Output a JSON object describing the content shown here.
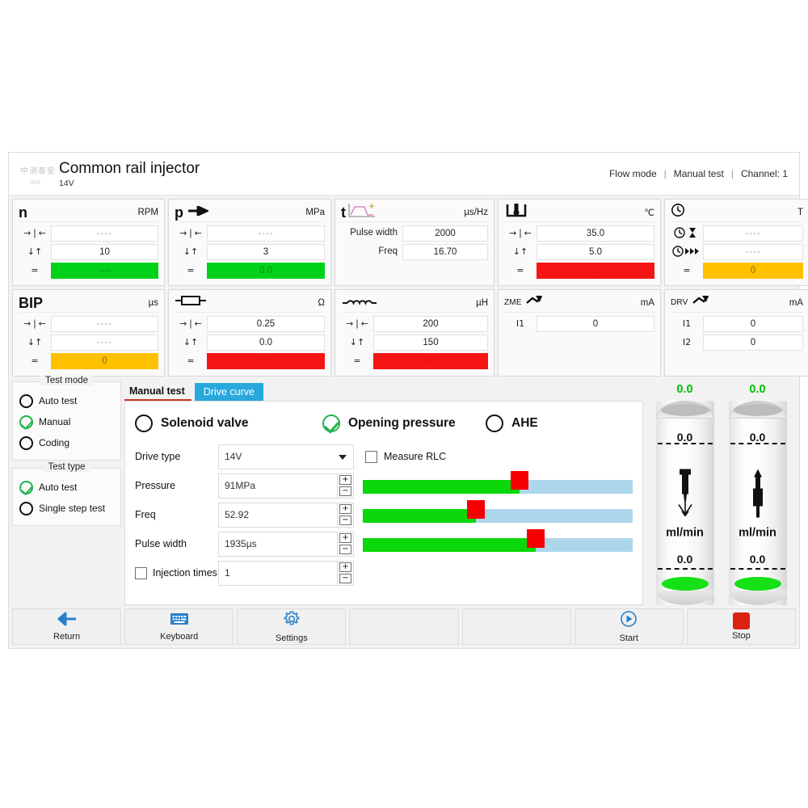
{
  "header": {
    "title": "Common rail injector",
    "subtitle": "14V",
    "logo_text": "中测泰安",
    "logo_sub": "test",
    "status": [
      "Flow mode",
      "Manual test",
      "Channel: 1"
    ],
    "separator": "|"
  },
  "gauges": [
    {
      "name": "speed",
      "symbol": "n",
      "unit": "RPM",
      "icon_head": "",
      "rows": [
        {
          "icon": "→❘←",
          "value": "----",
          "style": "dim"
        },
        {
          "icon": "↓↑",
          "value": "10",
          "style": "plain"
        },
        {
          "icon": "=",
          "value": "----",
          "style": "green"
        }
      ]
    },
    {
      "name": "bip",
      "symbol": "BIP",
      "unit": "µs",
      "rows": [
        {
          "icon": "→❘←",
          "value": "----",
          "style": "dim"
        },
        {
          "icon": "↓↑",
          "value": "----",
          "style": "dim"
        },
        {
          "icon": "=",
          "value": "0",
          "style": "amber"
        }
      ]
    },
    {
      "name": "pressure",
      "symbol": "p",
      "unit": "MPa",
      "icon_head": "arrow-right-icon",
      "rows": [
        {
          "icon": "→❘←",
          "value": "----",
          "style": "dim"
        },
        {
          "icon": "↓↑",
          "value": "3",
          "style": "plain"
        },
        {
          "icon": "=",
          "value": "0.0",
          "style": "green"
        }
      ]
    },
    {
      "name": "resistance",
      "symbol": "",
      "unit": "Ω",
      "icon_head": "resistor-icon",
      "rows": [
        {
          "icon": "→❘←",
          "value": "0.25",
          "style": "plain"
        },
        {
          "icon": "↓↑",
          "value": "0.0",
          "style": "plain"
        },
        {
          "icon": "=",
          "value": "0.0",
          "style": "red"
        }
      ]
    },
    {
      "name": "timing",
      "symbol": "t",
      "unit": "µs/Hz",
      "icon_head": "pulse-waveform-icon",
      "rows": [
        {
          "icon": "Pulse width",
          "value": "2000",
          "style": "plain",
          "wide": true
        },
        {
          "icon": "Freq",
          "value": "16.70",
          "style": "plain",
          "wide": true
        }
      ]
    },
    {
      "name": "inductance",
      "symbol": "",
      "unit": "µH",
      "icon_head": "inductor-coil-icon",
      "rows": [
        {
          "icon": "→❘←",
          "value": "200",
          "style": "plain"
        },
        {
          "icon": "↓↑",
          "value": "150",
          "style": "plain"
        },
        {
          "icon": "=",
          "value": "0.0",
          "style": "red"
        }
      ]
    },
    {
      "name": "temperature",
      "symbol": "",
      "unit": "℃",
      "icon_head": "thermometer-icon",
      "rows": [
        {
          "icon": "→❘←",
          "value": "35.0",
          "style": "plain"
        },
        {
          "icon": "↓↑",
          "value": "5.0",
          "style": "plain"
        },
        {
          "icon": "=",
          "value": "0.0",
          "style": "red"
        }
      ]
    },
    {
      "name": "zme-current",
      "symbol": "ZME",
      "unit": "mA",
      "icon_head": "connector-icon",
      "rows": [
        {
          "icon": "I1",
          "value": "0",
          "style": "plain"
        }
      ]
    },
    {
      "name": "time",
      "symbol": "",
      "unit": "T",
      "icon_head": "clock-icon",
      "rows": [
        {
          "icon": "clock-hourglass-icon",
          "value": "----",
          "style": "dim"
        },
        {
          "icon": "clock-fastforward-icon",
          "value": "----",
          "style": "dim"
        },
        {
          "icon": "=",
          "value": "0",
          "style": "amber"
        }
      ]
    },
    {
      "name": "drv-current",
      "symbol": "DRV",
      "unit": "mA",
      "icon_head": "connector-icon",
      "rows": [
        {
          "icon": "I1",
          "value": "0",
          "style": "plain"
        },
        {
          "icon": "I2",
          "value": "0",
          "style": "plain"
        }
      ]
    }
  ],
  "test_mode": {
    "legend": "Test mode",
    "options": [
      {
        "label": "Auto test",
        "selected": false
      },
      {
        "label": "Manual",
        "selected": true
      },
      {
        "label": "Coding",
        "selected": false
      }
    ]
  },
  "test_type": {
    "legend": "Test type",
    "options": [
      {
        "label": "Auto test",
        "selected": true
      },
      {
        "label": "Single step test",
        "selected": false
      }
    ]
  },
  "tabs": [
    {
      "label": "Manual test",
      "active": true
    },
    {
      "label": "Drive curve",
      "active": false
    }
  ],
  "valve_modes": [
    {
      "label": "Solenoid valve",
      "selected": false
    },
    {
      "label": "Opening pressure",
      "selected": true
    },
    {
      "label": "AHE",
      "selected": false
    }
  ],
  "form": {
    "drive_type_label": "Drive type",
    "drive_type_value": "14V",
    "measure_rlc_label": "Measure RLC",
    "measure_rlc_checked": false,
    "pressure_label": "Pressure",
    "pressure_value": "91MPa",
    "pressure_slider_pct": 58,
    "freq_label": "Freq",
    "freq_value": "52.92",
    "freq_slider_pct": 42,
    "pulse_width_label": "Pulse width",
    "pulse_width_value": "1935µs",
    "pulse_width_slider_pct": 64,
    "injection_times_label": "Injection times",
    "injection_times_value": "1",
    "injection_times_checked": false,
    "plus_glyph": "+",
    "minus_glyph": "−"
  },
  "cylinders": [
    {
      "name": "delivery",
      "top_value": "0.0",
      "upper_value": "0.0",
      "lower_value": "0.0",
      "unit": "ml/min",
      "icon": "injector-down-icon"
    },
    {
      "name": "backflow",
      "top_value": "0.0",
      "upper_value": "0.0",
      "lower_value": "0.0",
      "unit": "ml/min",
      "icon": "injector-up-icon"
    }
  ],
  "footer": [
    {
      "label": "Return",
      "icon": "back-arrow-icon"
    },
    {
      "label": "Keyboard",
      "icon": "keyboard-icon"
    },
    {
      "label": "Settings",
      "icon": "gear-icon"
    },
    {
      "label": "",
      "icon": ""
    },
    {
      "label": "",
      "icon": ""
    },
    {
      "label": "Start",
      "icon": "play-icon"
    },
    {
      "label": "Stop",
      "icon": "stop-icon"
    }
  ],
  "colors": {
    "green": "#00d21a",
    "red": "#f51515",
    "amber": "#ffc000",
    "tab_blue": "#29a8dd",
    "slider_track": "#aed6ea"
  }
}
